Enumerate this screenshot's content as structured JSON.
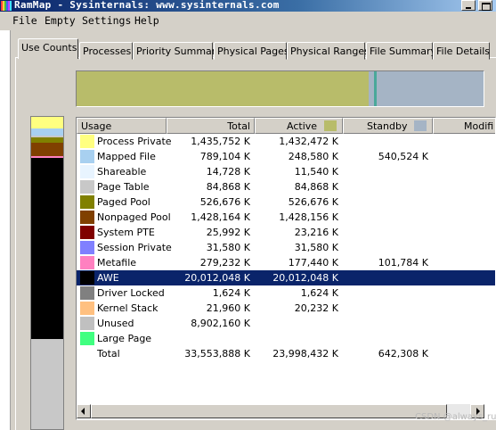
{
  "window": {
    "title": "RamMap - Sysinternals: www.sysinternals.com"
  },
  "menu": [
    "File",
    "Empty",
    "Settings",
    "Help"
  ],
  "tabs": [
    "Use Counts",
    "Processes",
    "Priority Summary",
    "Physical Pages",
    "Physical Ranges",
    "File Summary",
    "File Details"
  ],
  "active_tab": "Use Counts",
  "columns": {
    "usage": "Usage",
    "total": "Total",
    "active": "Active",
    "standby": "Standby",
    "modified": "Modifi"
  },
  "colors": {
    "active": "#b8bc6a",
    "standby": "#a5b4c5",
    "modified_standby": "#4aa89a",
    "selection": "#0a246a"
  },
  "active_fraction": 0.715,
  "rows": [
    {
      "usage": "Process Private",
      "total": "1,435,752 K",
      "active": "1,432,472 K",
      "standby": "",
      "color": "#ffff80"
    },
    {
      "usage": "Mapped File",
      "total": "789,104 K",
      "active": "248,580 K",
      "standby": "540,524 K",
      "color": "#a8d0f0"
    },
    {
      "usage": "Shareable",
      "total": "14,728 K",
      "active": "11,540 K",
      "standby": "",
      "color": "#e8f4ff"
    },
    {
      "usage": "Page Table",
      "total": "84,868 K",
      "active": "84,868 K",
      "standby": "",
      "color": "#c8c8c8"
    },
    {
      "usage": "Paged Pool",
      "total": "526,676 K",
      "active": "526,676 K",
      "standby": "",
      "color": "#808000"
    },
    {
      "usage": "Nonpaged Pool",
      "total": "1,428,164 K",
      "active": "1,428,156 K",
      "standby": "",
      "color": "#804000"
    },
    {
      "usage": "System PTE",
      "total": "25,992 K",
      "active": "23,216 K",
      "standby": "",
      "color": "#800000"
    },
    {
      "usage": "Session Private",
      "total": "31,580 K",
      "active": "31,580 K",
      "standby": "",
      "color": "#8080ff"
    },
    {
      "usage": "Metafile",
      "total": "279,232 K",
      "active": "177,440 K",
      "standby": "101,784 K",
      "color": "#ff80c0"
    },
    {
      "usage": "AWE",
      "total": "20,012,048 K",
      "active": "20,012,048 K",
      "standby": "",
      "color": "#000000",
      "selected": true
    },
    {
      "usage": "Driver Locked",
      "total": "1,624 K",
      "active": "1,624 K",
      "standby": "",
      "color": "#808080"
    },
    {
      "usage": "Kernel Stack",
      "total": "21,960 K",
      "active": "20,232 K",
      "standby": "",
      "color": "#ffc080"
    },
    {
      "usage": "Unused",
      "total": "8,902,160 K",
      "active": "",
      "standby": "",
      "color": "#c0c0c0"
    },
    {
      "usage": "Large Page",
      "total": "",
      "active": "",
      "standby": "",
      "color": "#40ff80"
    },
    {
      "usage": "Total",
      "total": "33,553,888 K",
      "active": "23,998,432 K",
      "standby": "642,308 K",
      "color": ""
    }
  ],
  "watermark": "CSDN @always_run"
}
